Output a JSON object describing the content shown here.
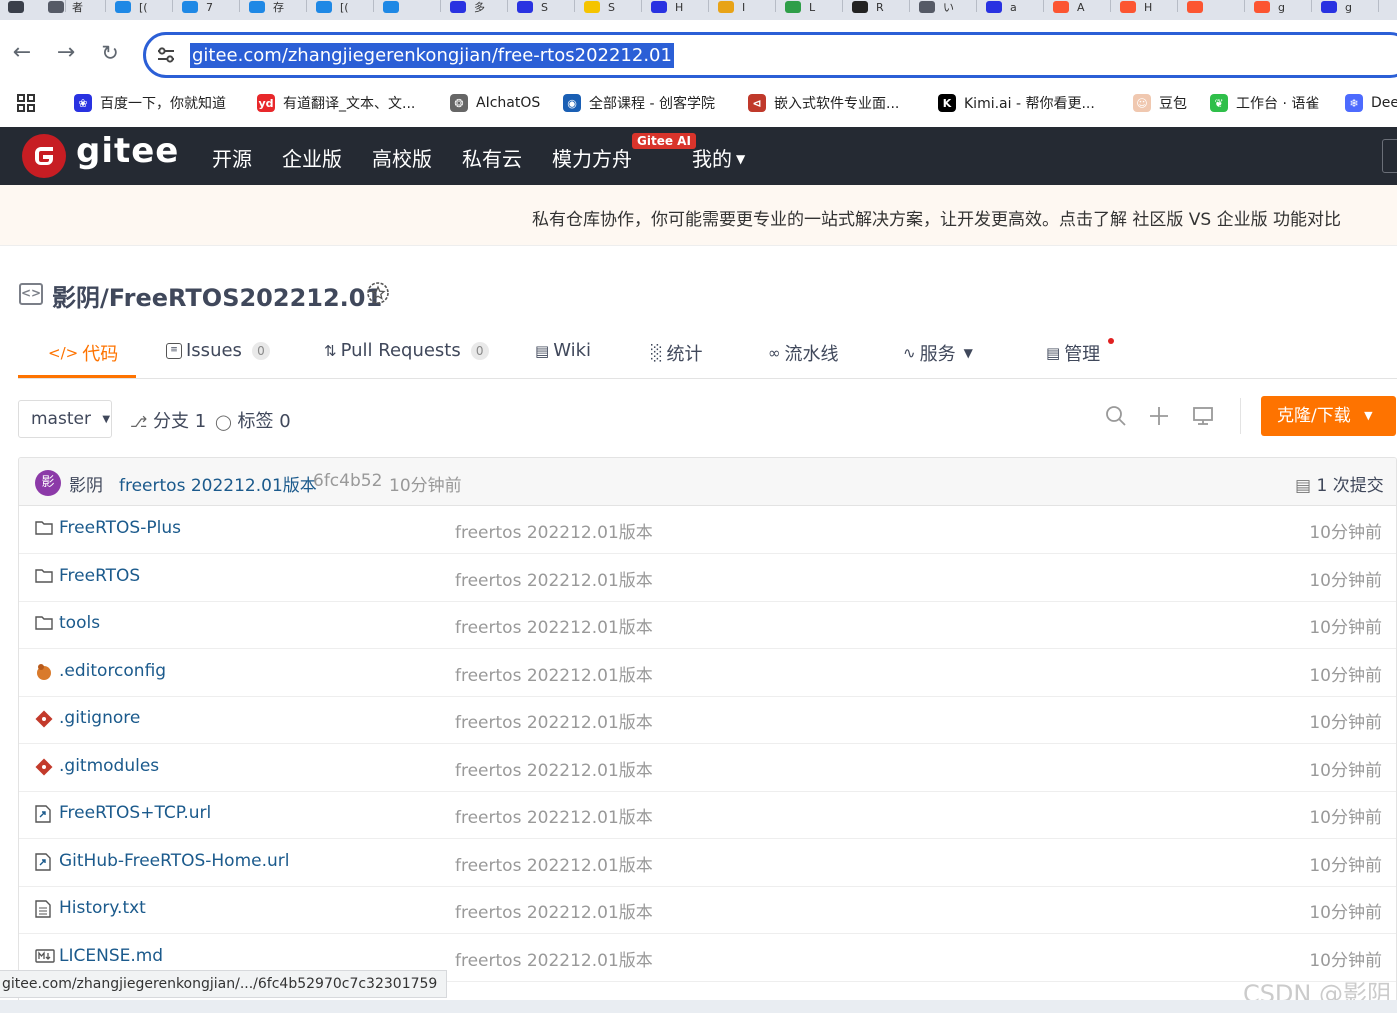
{
  "browser": {
    "tabs": [
      {
        "icon": "chevron-down-icon",
        "label": "",
        "color": "#3a3f4a"
      },
      {
        "icon": "globe-icon",
        "label": "者",
        "color": "#555a66"
      },
      {
        "icon": "app-icon",
        "label": "[(",
        "color": "#1e88e5"
      },
      {
        "icon": "app-icon",
        "label": "7",
        "color": "#1e88e5"
      },
      {
        "icon": "app-icon",
        "label": "存",
        "color": "#1e88e5"
      },
      {
        "icon": "app-icon",
        "label": "[(",
        "color": "#1e88e5"
      },
      {
        "icon": "app-icon",
        "label": "",
        "color": "#1e88e5"
      },
      {
        "icon": "baidu-paw-icon",
        "label": "多",
        "color": "#2932e1"
      },
      {
        "icon": "baidu-paw-icon",
        "label": "S",
        "color": "#2932e1"
      },
      {
        "icon": "ai-icon",
        "label": "S",
        "color": "#f5c400"
      },
      {
        "icon": "baidu-paw-icon",
        "label": "H",
        "color": "#2932e1"
      },
      {
        "icon": "book-icon",
        "label": "I",
        "color": "#e8a317"
      },
      {
        "icon": "sheet-icon",
        "label": "L",
        "color": "#2e9e48"
      },
      {
        "icon": "github-icon",
        "label": "R",
        "color": "#222222"
      },
      {
        "icon": "globe-icon",
        "label": "い",
        "color": "#555a66"
      },
      {
        "icon": "baidu-paw-icon",
        "label": "a",
        "color": "#2932e1"
      },
      {
        "icon": "csdn-icon",
        "label": "A",
        "color": "#fc5531"
      },
      {
        "icon": "csdn-icon",
        "label": "H",
        "color": "#fc5531"
      },
      {
        "icon": "csdn-icon",
        "label": "",
        "color": "#fc5531"
      },
      {
        "icon": "csdn-icon",
        "label": "g",
        "color": "#fc5531"
      },
      {
        "icon": "baidu-paw-icon",
        "label": "g",
        "color": "#2932e1"
      }
    ],
    "url": "gitee.com/zhangjiegerenkongjian/free-rtos202212.01",
    "bookmarks": [
      {
        "label": "百度一下，你就知道",
        "icon": "baidu-paw-icon",
        "color": "#2932e1",
        "glyph": "❀"
      },
      {
        "label": "有道翻译_文本、文...",
        "icon": "youdao-icon",
        "color": "#e8282b",
        "glyph": "yd"
      },
      {
        "label": "AIchatOS",
        "icon": "openai-icon",
        "color": "#666666",
        "glyph": "❂"
      },
      {
        "label": "全部课程 - 创客学院",
        "icon": "globe-icon",
        "color": "#1a5fb4",
        "glyph": "◉"
      },
      {
        "label": "嵌入式软件专业面...",
        "icon": "code-icon",
        "color": "#c0392b",
        "glyph": "⊲"
      },
      {
        "label": "Kimi.ai - 帮你看更...",
        "icon": "kimi-icon",
        "color": "#000000",
        "glyph": "K"
      },
      {
        "label": "豆包",
        "icon": "doubao-icon",
        "color": "#f0c8b0",
        "glyph": "☺"
      },
      {
        "label": "工作台 · 语雀",
        "icon": "yuque-icon",
        "color": "#2fbf4a",
        "glyph": "❦"
      },
      {
        "label": "Dee",
        "icon": "deepseek-icon",
        "color": "#4d6bfe",
        "glyph": "❄"
      }
    ]
  },
  "gitee": {
    "brand": "gitee",
    "nav": [
      "开源",
      "企业版",
      "高校版",
      "私有云",
      "模力方舟",
      "我的"
    ],
    "ai_badge": "Gitee AI",
    "promo": "私有仓库协作，你可能需要更专业的一站式解决方案，让开发更高效。点击了解 社区版 VS 企业版 功能对比",
    "accent": "#fe7300",
    "header_bg": "#252a33"
  },
  "repo": {
    "title": "影阴/FreeRTOS202212.01",
    "tabs": [
      {
        "label": "代码",
        "icon": "code-icon",
        "count": null
      },
      {
        "label": "Issues",
        "icon": "issues-icon",
        "count": "0"
      },
      {
        "label": "Pull Requests",
        "icon": "pull-request-icon",
        "count": "0"
      },
      {
        "label": "Wiki",
        "icon": "wiki-icon",
        "count": null
      },
      {
        "label": "统计",
        "icon": "stats-icon",
        "count": null
      },
      {
        "label": "流水线",
        "icon": "pipeline-icon",
        "count": null
      },
      {
        "label": "服务",
        "icon": "service-icon",
        "count": null
      },
      {
        "label": "管理",
        "icon": "manage-icon",
        "count": null
      }
    ],
    "branch": "master",
    "branches": "分支 1",
    "tags": "标签 0",
    "clone_label": "克隆/下载",
    "commit": {
      "avatar_char": "影",
      "author": "影阴",
      "message": "freertos 202212.01版本",
      "hash": "6fc4b52",
      "time": "10分钟前",
      "count": "1 次提交"
    },
    "files": [
      {
        "name": "FreeRTOS-Plus",
        "type": "folder",
        "message": "freertos 202212.01版本",
        "time": "10分钟前"
      },
      {
        "name": "FreeRTOS",
        "type": "folder",
        "message": "freertos 202212.01版本",
        "time": "10分钟前"
      },
      {
        "name": "tools",
        "type": "folder",
        "message": "freertos 202212.01版本",
        "time": "10分钟前"
      },
      {
        "name": ".editorconfig",
        "type": "editorconfig",
        "message": "freertos 202212.01版本",
        "time": "10分钟前"
      },
      {
        "name": ".gitignore",
        "type": "git",
        "message": "freertos 202212.01版本",
        "time": "10分钟前"
      },
      {
        "name": ".gitmodules",
        "type": "git",
        "message": "freertos 202212.01版本",
        "time": "10分钟前"
      },
      {
        "name": "FreeRTOS+TCP.url",
        "type": "link",
        "message": "freertos 202212.01版本",
        "time": "10分钟前"
      },
      {
        "name": "GitHub-FreeRTOS-Home.url",
        "type": "link",
        "message": "freertos 202212.01版本",
        "time": "10分钟前"
      },
      {
        "name": "History.txt",
        "type": "text",
        "message": "freertos 202212.01版本",
        "time": "10分钟前"
      },
      {
        "name": "LICENSE.md",
        "type": "markdown",
        "message": "freertos 202212.01版本",
        "time": "10分钟前"
      }
    ]
  },
  "status_url": "gitee.com/zhangjiegerenkongjian/.../6fc4b52970c7c32301759",
  "watermark": "CSDN @影阴"
}
